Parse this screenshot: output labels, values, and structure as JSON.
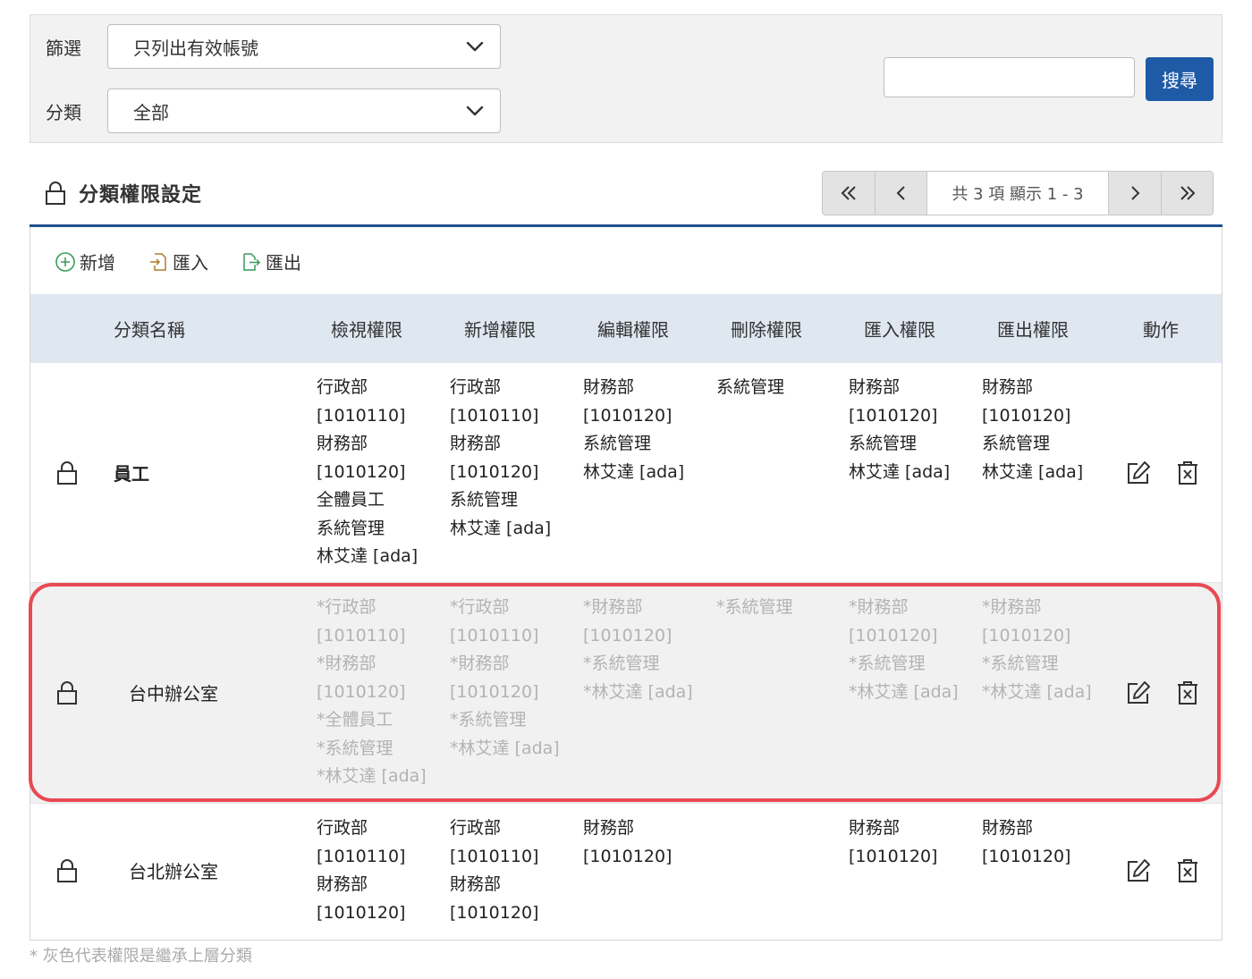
{
  "filter": {
    "label_filter": "篩選",
    "filter_value": "只列出有效帳號",
    "label_category": "分類",
    "category_value": "全部",
    "search_value": "",
    "search_button": "搜尋"
  },
  "section": {
    "title": "分類權限設定",
    "pager_info": "共 3 項 顯示 1 - 3"
  },
  "toolbar": {
    "add": "新增",
    "import": "匯入",
    "export": "匯出"
  },
  "table": {
    "headers": [
      "分類名稱",
      "檢視權限",
      "新增權限",
      "編輯權限",
      "刪除權限",
      "匯入權限",
      "匯出權限",
      "動作"
    ],
    "rows": [
      {
        "name": "員工",
        "inherited": false,
        "view": "行政部\n[1010110]\n財務部\n[1010120]\n全體員工\n系統管理\n林艾達 [ada]",
        "add": "行政部\n[1010110]\n財務部\n[1010120]\n系統管理\n林艾達 [ada]",
        "edit": "財務部\n[1010120]\n系統管理\n林艾達 [ada]",
        "delete": "系統管理",
        "import": "財務部\n[1010120]\n系統管理\n林艾達 [ada]",
        "export": "財務部\n[1010120]\n系統管理\n林艾達 [ada]"
      },
      {
        "name": "台中辦公室",
        "inherited": true,
        "view": "*行政部\n[1010110]\n*財務部\n[1010120]\n*全體員工\n*系統管理\n*林艾達 [ada]",
        "add": "*行政部\n[1010110]\n*財務部\n[1010120]\n*系統管理\n*林艾達 [ada]",
        "edit": "*財務部\n[1010120]\n*系統管理\n*林艾達 [ada]",
        "delete": "*系統管理",
        "import": "*財務部\n[1010120]\n*系統管理\n*林艾達 [ada]",
        "export": "*財務部\n[1010120]\n*系統管理\n*林艾達 [ada]"
      },
      {
        "name": "台北辦公室",
        "inherited": false,
        "view": "行政部\n[1010110]\n財務部\n[1010120]",
        "add": "行政部\n[1010110]\n財務部\n[1010120]",
        "edit": "財務部\n[1010120]",
        "delete": "",
        "import": "財務部\n[1010120]",
        "export": "財務部\n[1010120]"
      }
    ]
  },
  "footnote": "* 灰色代表權限是繼承上層分類",
  "colors": {
    "primary": "#1f5aa7",
    "header_bg": "#dfe7f1",
    "highlight": "#e84a55",
    "inherited_text": "#b3b3b3"
  },
  "icons": [
    "chevron-down-icon",
    "lock-icon",
    "first-page-icon",
    "prev-page-icon",
    "next-page-icon",
    "last-page-icon",
    "add-circle-icon",
    "import-icon",
    "export-icon",
    "edit-icon",
    "delete-icon"
  ]
}
